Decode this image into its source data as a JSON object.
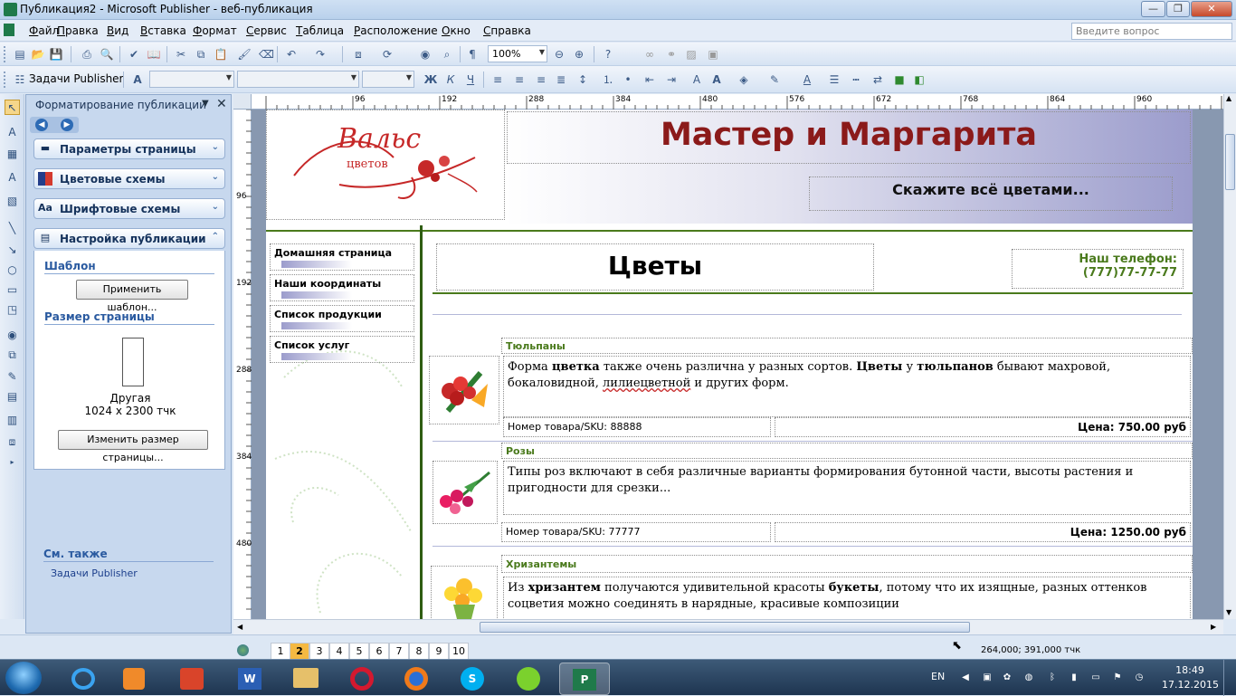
{
  "window": {
    "title": "Публикация2 - Microsoft Publisher - веб-публикация"
  },
  "menu": [
    "Файл",
    "Правка",
    "Вид",
    "Вставка",
    "Формат",
    "Сервис",
    "Таблица",
    "Расположение",
    "Окно",
    "Справка"
  ],
  "help_search": {
    "placeholder": "Введите вопрос"
  },
  "toolbar1": {
    "zoom": "100%"
  },
  "toolbar2": {
    "tasks_label": "Задачи Publisher"
  },
  "taskpane": {
    "title": "Форматирование публикации",
    "sections": [
      "Параметры страницы",
      "Цветовые схемы",
      "Шрифтовые схемы",
      "Настройка публикации"
    ],
    "template_label": "Шаблон",
    "apply_template_button": "Применить шаблон...",
    "page_size_label": "Размер страницы",
    "page_size_name": "Другая",
    "page_size_value": "1024 x 2300 тчк",
    "resize_button": "Изменить размер страницы...",
    "see_also_label": "См. также",
    "see_also_link": "Задачи Publisher"
  },
  "rulers": {
    "horizontal": [
      "96",
      "192",
      "288",
      "384",
      "480",
      "576",
      "672",
      "768",
      "864",
      "960"
    ],
    "vertical": [
      "96",
      "192",
      "288",
      "384",
      "480"
    ]
  },
  "page": {
    "logo_text_1": "Вальс",
    "logo_text_2": "цветов",
    "site_title": "Мастер и Маргарита",
    "tagline": "Скажите всё цветами...",
    "nav": [
      "Домашняя страница",
      "Наши координаты",
      "Список продукции",
      "Список услуг"
    ],
    "section_title": "Цветы",
    "phone_label": "Наш телефон:",
    "phone_number": "(777)77-77-77",
    "products": [
      {
        "name": "Тюльпаны",
        "sku": "Номер товара/SKU: 88888",
        "price": "Цена: 750.00 руб"
      },
      {
        "name": "Розы",
        "description": "Типы роз включают в себя различные варианты формирования бутонной части, высоты растения и пригодности для срезки...",
        "sku": "Номер товара/SKU: 77777",
        "price": "Цена: 1250.00 руб"
      },
      {
        "name": "Хризантемы"
      }
    ]
  },
  "status": {
    "pages": [
      "1",
      "2",
      "3",
      "4",
      "5",
      "6",
      "7",
      "8",
      "9",
      "10"
    ],
    "current_page": "2",
    "coords": "264,000; 391,000 тчк"
  },
  "taskbar": {
    "lang": "EN",
    "time": "18:49",
    "date": "17.12.2015"
  },
  "colors": {
    "accent_title": "#8b1a1a",
    "green": "#4a7a1c",
    "header_gradient_end": "#9b9ccc"
  }
}
